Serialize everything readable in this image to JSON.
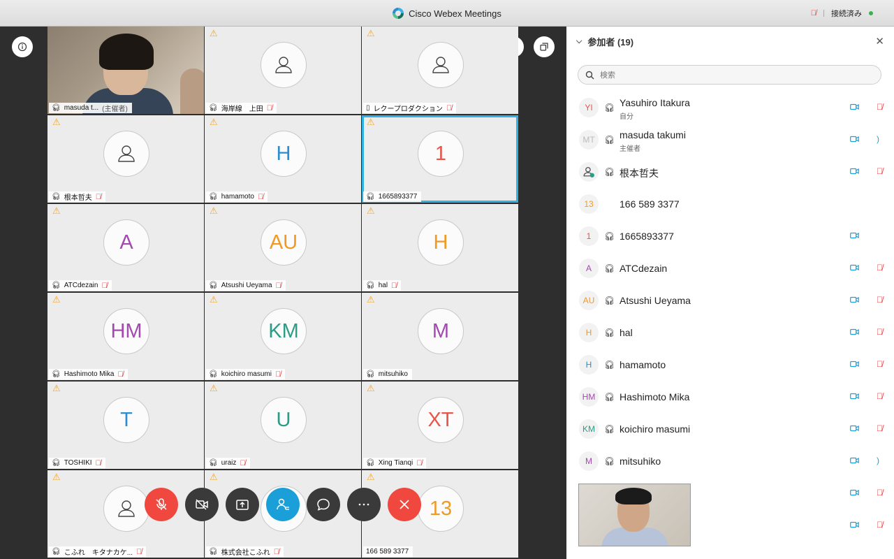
{
  "app": {
    "title": "Cisco Webex Meetings",
    "status": "接続済み"
  },
  "panel": {
    "title": "参加者 (19)",
    "search_placeholder": "検索"
  },
  "tiles": [
    {
      "name": "masuda t...",
      "role": "(主催者)",
      "kind": "video",
      "muted": false,
      "device": "headset"
    },
    {
      "name": "海岸線　上田",
      "kind": "person",
      "muted": true,
      "device": "headset"
    },
    {
      "name": "レクープロダクション",
      "kind": "person",
      "muted": true,
      "device": "phone"
    },
    {
      "name": "根本哲夫",
      "kind": "person",
      "muted": true,
      "device": "headset"
    },
    {
      "name": "hamamoto",
      "initials": "H",
      "color": "#2a8ed0",
      "muted": true,
      "device": "headset"
    },
    {
      "name": "1665893377",
      "initials": "1",
      "color": "#e8554a",
      "muted": false,
      "device": "headset",
      "active": true
    },
    {
      "name": "ATCdezain",
      "initials": "A",
      "color": "#a24aae",
      "muted": true,
      "device": "headset"
    },
    {
      "name": "Atsushi Ueyama",
      "initials": "AU",
      "color": "#f09a26",
      "muted": true,
      "device": "headset"
    },
    {
      "name": "hal",
      "initials": "H",
      "color": "#f09a26",
      "muted": true,
      "device": "headset"
    },
    {
      "name": "Hashimoto Mika",
      "initials": "HM",
      "color": "#a24aae",
      "muted": true,
      "device": "headset"
    },
    {
      "name": "koichiro masumi",
      "initials": "KM",
      "color": "#2b9c86",
      "muted": true,
      "device": "headset"
    },
    {
      "name": "mitsuhiko",
      "initials": "M",
      "color": "#a24aae",
      "muted": false,
      "device": "headset"
    },
    {
      "name": "TOSHIKI",
      "initials": "T",
      "color": "#2a8ed0",
      "muted": true,
      "device": "headset"
    },
    {
      "name": "uraiz",
      "initials": "U",
      "color": "#2b9c86",
      "muted": true,
      "device": "headset"
    },
    {
      "name": "Xing Tianqi",
      "initials": "XT",
      "color": "#e8554a",
      "muted": true,
      "device": "headset"
    },
    {
      "name": "こふれ　キタナカケ...",
      "kind": "person",
      "muted": true,
      "device": "headset"
    },
    {
      "name": "株式会社こふれ",
      "kind": "person",
      "muted": true,
      "device": "headset"
    },
    {
      "name": "166 589 3377",
      "initials": "13",
      "color": "#f09a26",
      "muted": false,
      "device": "none"
    }
  ],
  "participants": [
    {
      "initials": "YI",
      "color": "#e8554a",
      "name": "Yasuhiro Itakura",
      "sub": "自分",
      "headset": true,
      "cam": true,
      "mic": "muted"
    },
    {
      "initials": "MT",
      "color": "#bbbbbb",
      "name": "masuda takumi",
      "sub": "主催者",
      "headset": true,
      "cam": true,
      "mic": "active"
    },
    {
      "initials": "",
      "color": "#555",
      "name": "根本哲夫",
      "sub": "",
      "headset": true,
      "cam": true,
      "mic": "muted",
      "person": true
    },
    {
      "initials": "13",
      "color": "#f09a26",
      "name": "166 589 3377",
      "sub": "",
      "headset": false,
      "cam": false,
      "mic": "none"
    },
    {
      "initials": "1",
      "color": "#e8554a",
      "name": "1665893377",
      "sub": "",
      "headset": true,
      "cam": true,
      "mic": "none"
    },
    {
      "initials": "A",
      "color": "#a24aae",
      "name": "ATCdezain",
      "sub": "",
      "headset": true,
      "cam": true,
      "mic": "muted"
    },
    {
      "initials": "AU",
      "color": "#f09a26",
      "name": "Atsushi Ueyama",
      "sub": "",
      "headset": true,
      "cam": true,
      "mic": "muted"
    },
    {
      "initials": "H",
      "color": "#f09a26",
      "name": "hal",
      "sub": "",
      "headset": true,
      "cam": true,
      "mic": "muted"
    },
    {
      "initials": "H",
      "color": "#2a8ed0",
      "name": "hamamoto",
      "sub": "",
      "headset": true,
      "cam": true,
      "mic": "muted"
    },
    {
      "initials": "HM",
      "color": "#a24aae",
      "name": "Hashimoto Mika",
      "sub": "",
      "headset": true,
      "cam": true,
      "mic": "muted"
    },
    {
      "initials": "KM",
      "color": "#2b9c86",
      "name": "koichiro masumi",
      "sub": "",
      "headset": true,
      "cam": true,
      "mic": "muted"
    },
    {
      "initials": "M",
      "color": "#a24aae",
      "name": "mitsuhiko",
      "sub": "",
      "headset": true,
      "cam": true,
      "mic": "active"
    },
    {
      "initials": "",
      "color": "#2a8ed0",
      "name": "",
      "sub": "",
      "headset": false,
      "cam": true,
      "mic": "muted"
    },
    {
      "initials": "",
      "color": "#2a8ed0",
      "name": "",
      "sub": "",
      "headset": false,
      "cam": true,
      "mic": "muted"
    }
  ],
  "controls": [
    {
      "name": "mute-button",
      "icon": "mic-off-icon",
      "style": "red"
    },
    {
      "name": "stop-video-button",
      "icon": "video-off-icon",
      "style": "dark"
    },
    {
      "name": "share-button",
      "icon": "share-icon",
      "style": "dark"
    },
    {
      "name": "participants-button",
      "icon": "participants-icon",
      "style": "blue"
    },
    {
      "name": "chat-button",
      "icon": "chat-icon",
      "style": "dark"
    },
    {
      "name": "more-button",
      "icon": "more-icon",
      "style": "dark"
    },
    {
      "name": "leave-button",
      "icon": "close-icon",
      "style": "red"
    }
  ]
}
